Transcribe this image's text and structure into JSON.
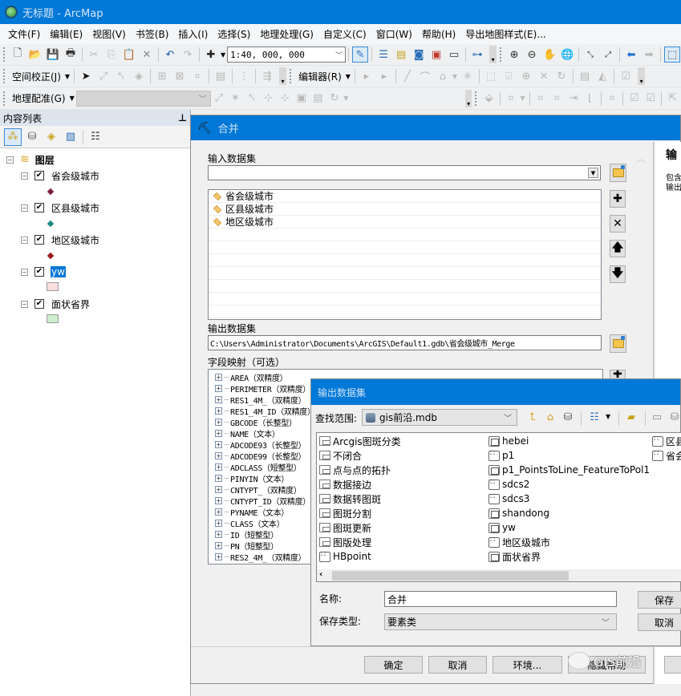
{
  "window": {
    "title": "无标题 - ArcMap"
  },
  "menu": [
    "文件(F)",
    "编辑(E)",
    "视图(V)",
    "书签(B)",
    "插入(I)",
    "选择(S)",
    "地理处理(G)",
    "自定义(C)",
    "窗口(W)",
    "帮助(H)",
    "导出地图样式(E)..."
  ],
  "toolbar": {
    "scale": "1:40, 000, 000",
    "spatial_adjust_label": "空间校正(J)",
    "editor_label": "编辑器(R)",
    "georef_label": "地理配准(G)"
  },
  "toc": {
    "title": "内容列表",
    "pin": "ᵽ",
    "root": "图层",
    "layers": [
      {
        "name": "省会级城市",
        "checked": true,
        "symbol": "point",
        "color": "#7a1f3c"
      },
      {
        "name": "区县级城市",
        "checked": true,
        "symbol": "point",
        "color": "#1f8a80"
      },
      {
        "name": "地区级城市",
        "checked": true,
        "symbol": "point",
        "color": "#9a1a1a"
      },
      {
        "name": "yw",
        "checked": true,
        "selected": true,
        "symbol": "polygon",
        "color": "#fcdede"
      },
      {
        "name": "面状省界",
        "checked": true,
        "symbol": "polygon",
        "color": "#cfeecf"
      }
    ]
  },
  "merge_dialog": {
    "title": "合并",
    "input_label": "输入数据集",
    "input_value": "",
    "input_items": [
      "省会级城市",
      "区县级城市",
      "地区级城市"
    ],
    "output_label": "输出数据集",
    "output_value": "C:\\Users\\Administrator\\Documents\\ArcGIS\\Default1.gdb\\省会级城市_Merge",
    "fieldmap_label": "字段映射（可选）",
    "fields": [
      "AREA（双精度）",
      "PERIMETER（双精度）",
      "RES1_4M_（双精度）",
      "RES1_4M_ID（双精度）",
      "GBCODE（长整型）",
      "NAME（文本）",
      "ADCODE93（长整型）",
      "ADCODE99（长整型）",
      "ADCLASS（短整型）",
      "PINYIN（文本）",
      "CNTYPT_（双精度）",
      "CNTYPT_ID（双精度）",
      "PYNAME（文本）",
      "CLASS（文本）",
      "ID（短整型）",
      "PN（短整型）",
      "RES2_4M_（双精度）"
    ],
    "help_title": "输",
    "help_lines": [
      "包含",
      "输出"
    ],
    "buttons": {
      "ok": "确定",
      "cancel": "取消",
      "env": "环境...",
      "help": "隐藏帮助"
    }
  },
  "save_dialog": {
    "title": "输出数据集",
    "lookin_label": "查找范围:",
    "lookin_value": "gis前沿.mdb",
    "items_col1": [
      {
        "name": "Arcgis图斑分类",
        "type": "dataset"
      },
      {
        "name": "不闭合",
        "type": "dataset"
      },
      {
        "name": "点与点的拓扑",
        "type": "dataset"
      },
      {
        "name": "数据接边",
        "type": "dataset"
      },
      {
        "name": "数据转图斑",
        "type": "dataset"
      },
      {
        "name": "图斑分割",
        "type": "dataset"
      },
      {
        "name": "图斑更新",
        "type": "dataset"
      },
      {
        "name": "图版处理",
        "type": "dataset"
      },
      {
        "name": "HBpoint",
        "type": "point"
      }
    ],
    "items_col2": [
      {
        "name": "hebei",
        "type": "polygon"
      },
      {
        "name": "p1",
        "type": "point"
      },
      {
        "name": "p1_PointsToLine_FeatureToPol1",
        "type": "polygon"
      },
      {
        "name": "sdcs2",
        "type": "point"
      },
      {
        "name": "sdcs3",
        "type": "point"
      },
      {
        "name": "shandong",
        "type": "polygon"
      },
      {
        "name": "yw",
        "type": "polygon"
      },
      {
        "name": "地区级城市",
        "type": "point"
      },
      {
        "name": "面状省界",
        "type": "polygon"
      }
    ],
    "items_col3": [
      {
        "name": "区县级城市",
        "type": "point"
      },
      {
        "name": "省会级城市",
        "type": "point"
      }
    ],
    "name_label": "名称:",
    "name_value": "合并",
    "type_label": "保存类型:",
    "type_value": "要素类",
    "save_button": "保存",
    "cancel_button": "取消"
  },
  "watermark": "GIS前沿"
}
